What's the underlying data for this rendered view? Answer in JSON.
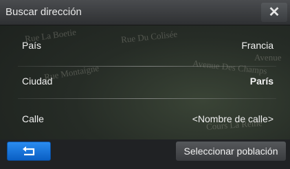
{
  "header": {
    "title": "Buscar dirección",
    "close_icon": "close-icon"
  },
  "map_labels": {
    "label1": "Rue La Boetie",
    "label2": "Rue Du Colisée",
    "label3": "Rue Montaigne",
    "label4": "Avenue Des Champs",
    "label5": "Avenue",
    "label6": "Cours La Reine"
  },
  "form": {
    "country_label": "País",
    "country_value": "Francia",
    "city_label": "Ciudad",
    "city_value": "París",
    "street_label": "Calle",
    "street_value": "<Nombre de calle>"
  },
  "footer": {
    "back_icon": "back-arrow-icon",
    "select_label": "Seleccionar población"
  },
  "colors": {
    "accent": "#1b78e0",
    "background": "#262c26"
  }
}
